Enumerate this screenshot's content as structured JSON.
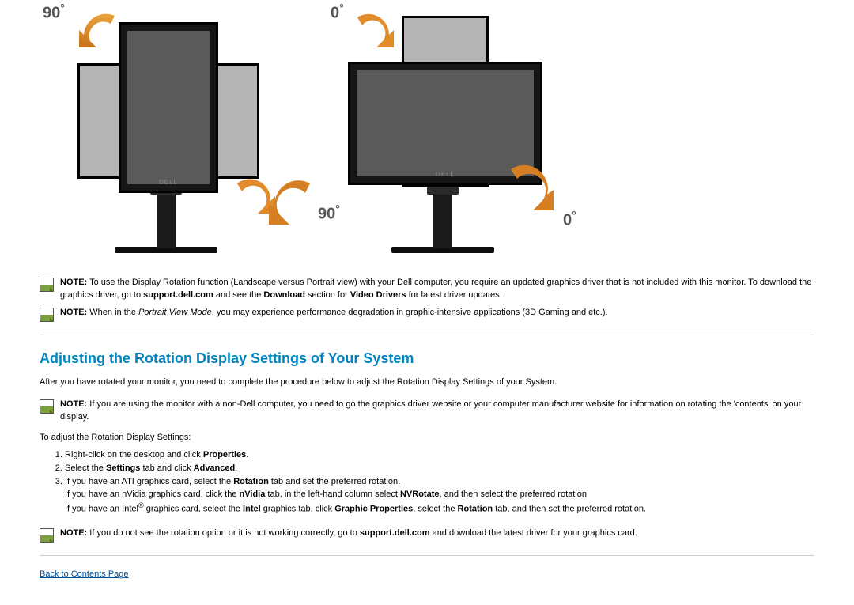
{
  "labels": {
    "ninety": "90",
    "zero": "0"
  },
  "note1": {
    "lead": "NOTE:",
    "text1": " To use the Display Rotation function (Landscape versus Portrait view) with your Dell computer, you require an updated graphics driver that is not included with this monitor. To download the graphics driver, go to ",
    "b1": "support.dell.com",
    "text2": " and see the ",
    "b2": "Download",
    "text3": " section for ",
    "b3": "Video Drivers",
    "text4": " for latest driver updates."
  },
  "note2": {
    "lead": "NOTE:",
    "text1": " When in the ",
    "em1": "Portrait View Mode",
    "text2": ", you may experience performance degradation in graphic-intensive applications (3D Gaming and etc.)."
  },
  "section_heading": "Adjusting the Rotation Display Settings of Your System",
  "intro": "After you have rotated your monitor, you need to complete the procedure below to adjust the Rotation Display Settings of your System.",
  "note3": {
    "lead": "NOTE:",
    "text1": " If you are using the monitor with a non-Dell computer, you need to go the graphics driver website or your computer manufacturer website for information on rotating the 'contents' on your display."
  },
  "steps_intro": "To adjust the Rotation Display Settings:",
  "steps": {
    "s1": {
      "t1": "Right-click on the desktop and click ",
      "b1": "Properties",
      "t2": "."
    },
    "s2": {
      "t1": "Select the ",
      "b1": "Settings",
      "t2": " tab and click ",
      "b2": "Advanced",
      "t3": "."
    },
    "s3": {
      "line1_t1": "If you have an ATI graphics card, select the ",
      "line1_b1": "Rotation",
      "line1_t2": " tab and set the preferred rotation.",
      "line2_t1": "If you have an nVidia graphics card, click the ",
      "line2_b1": "nVidia",
      "line2_t2": " tab, in the left-hand column select ",
      "line2_b2": "NVRotate",
      "line2_t3": ", and then select the preferred rotation.",
      "line3_t1": "If you have an Intel",
      "line3_sup": "®",
      "line3_t1b": " graphics card, select the ",
      "line3_b1": "Intel",
      "line3_t2": " graphics tab, click ",
      "line3_b2": "Graphic Properties",
      "line3_t3": ", select the ",
      "line3_b3": "Rotation",
      "line3_t4": " tab, and then set the preferred rotation."
    }
  },
  "note4": {
    "lead": "NOTE:",
    "text1": " If you do not see the rotation option or it is not working correctly, go to ",
    "b1": "support.dell.com",
    "text2": " and download the latest driver for your graphics card."
  },
  "back_link": "Back to Contents Page"
}
